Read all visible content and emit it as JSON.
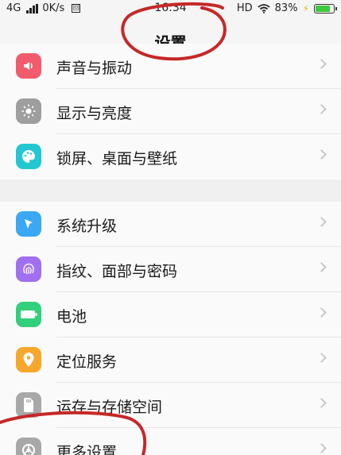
{
  "status_bar": {
    "network": "4G",
    "speed": "0K/s",
    "time": "16:34",
    "hd": "HD",
    "battery_percent": "83%",
    "battery_level": 0.83,
    "battery_color": "#3fc93f"
  },
  "header": {
    "title": "设置"
  },
  "group1": {
    "items": [
      {
        "label": "声音与振动",
        "icon": "sound-icon",
        "color": "#f25b6b"
      },
      {
        "label": "显示与亮度",
        "icon": "brightness-icon",
        "color": "#9e9e9e"
      },
      {
        "label": "锁屏、桌面与壁纸",
        "icon": "palette-icon",
        "color": "#22c7d1"
      }
    ]
  },
  "group2": {
    "items": [
      {
        "label": "系统升级",
        "icon": "system-update-icon",
        "color": "#3aa8f2"
      },
      {
        "label": "指纹、面部与密码",
        "icon": "fingerprint-icon",
        "color": "#a070f0"
      },
      {
        "label": "电池",
        "icon": "battery-icon",
        "color": "#31d07a"
      },
      {
        "label": "定位服务",
        "icon": "location-icon",
        "color": "#f7a72b"
      },
      {
        "label": "运存与存储空间",
        "icon": "storage-icon",
        "color": "#a8a8a8"
      },
      {
        "label": "更多设置",
        "icon": "gear-icon",
        "color": "#a8a8a8"
      }
    ]
  },
  "annotation_color": "#c62828"
}
